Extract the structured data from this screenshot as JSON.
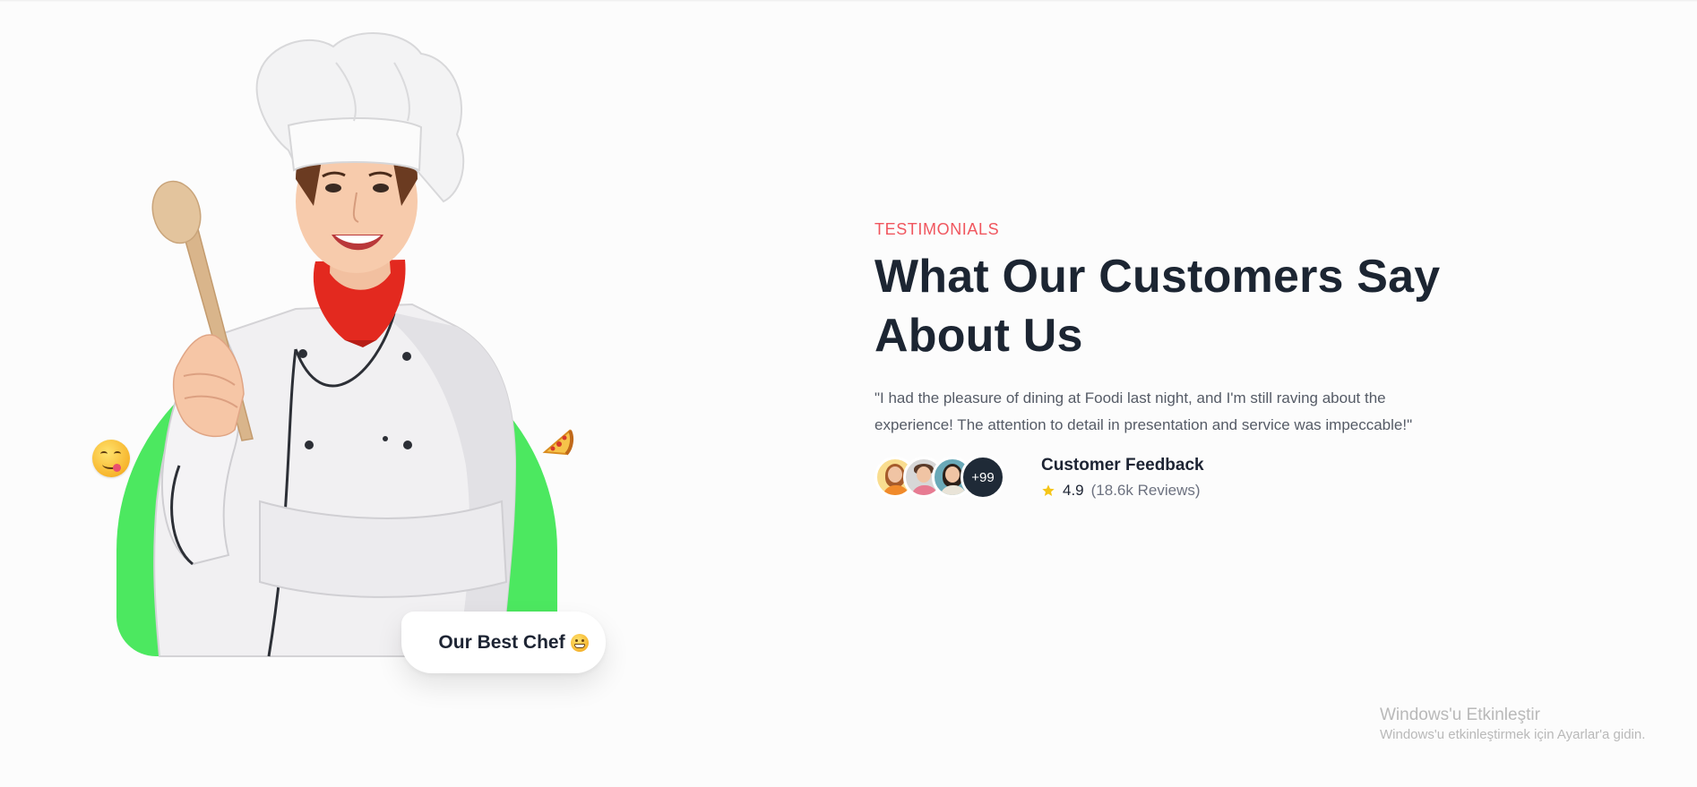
{
  "section": {
    "eyebrow": "TESTIMONIALS",
    "headline_line1": "What Our Customers Say",
    "headline_line2": "About Us",
    "quote": "\"I had the pleasure of dining at Foodi last night, and I'm still raving about the experience! The attention to detail in presentation and service was impeccable!\""
  },
  "feedback": {
    "title": "Customer Feedback",
    "rating": "4.9",
    "reviews": "(18.6k Reviews)",
    "more_count": "+99"
  },
  "badge": {
    "label": "Our Best Chef"
  },
  "windows_watermark": {
    "title": "Windows'u Etkinleştir",
    "subtitle": "Windows'u etkinleştirmek için Ayarlar'a gidin."
  },
  "icons": {
    "rating_star": "star-icon",
    "left_emoji": "yum-face-icon",
    "right_emoji": "pizza-icon",
    "badge_emoji": "grin-face-icon"
  },
  "colors": {
    "accent": "#f0565e",
    "arch_green": "#4ce860",
    "heading": "#1c2532",
    "star": "#f5c518"
  }
}
